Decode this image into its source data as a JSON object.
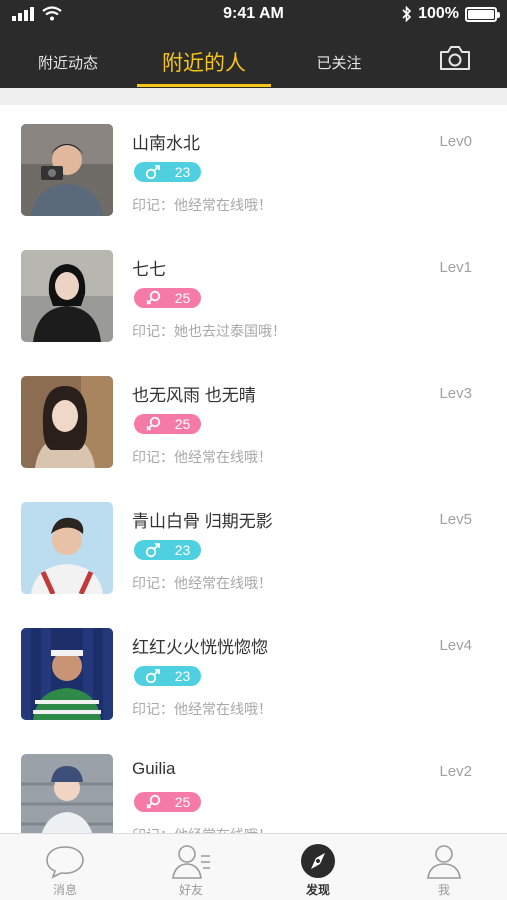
{
  "status_bar": {
    "time": "9:41 AM",
    "battery_percent": "100%",
    "battery_level": 1.0,
    "icons": [
      "signal-icon",
      "wifi-icon",
      "bluetooth-icon",
      "battery-icon"
    ]
  },
  "tabs": [
    {
      "label": "附近动态",
      "active": false
    },
    {
      "label": "附近的人",
      "active": true
    },
    {
      "label": "已关注",
      "active": false
    }
  ],
  "camera_icon": "camera-icon",
  "colors": {
    "top_bar": "#2b2b2b",
    "accent": "#f5c518",
    "male_badge": "#4fd0e0",
    "female_badge": "#f57aa6"
  },
  "people": [
    {
      "name": "山南水北",
      "level": "Lev0",
      "gender": "male",
      "age": "23",
      "note": "印记：他经常在线哦！"
    },
    {
      "name": "七七",
      "level": "Lev1",
      "gender": "female",
      "age": "25",
      "note": "印记：她也去过泰国哦！"
    },
    {
      "name": "也无风雨 也无晴",
      "level": "Lev3",
      "gender": "female",
      "age": "25",
      "note": "印记：他经常在线哦！"
    },
    {
      "name": "青山白骨 归期无影",
      "level": "Lev5",
      "gender": "male",
      "age": "23",
      "note": "印记：他经常在线哦！"
    },
    {
      "name": "红红火火恍恍惚惚",
      "level": "Lev4",
      "gender": "male",
      "age": "23",
      "note": "印记：他经常在线哦！"
    },
    {
      "name": "Guilia",
      "level": "Lev2",
      "gender": "female",
      "age": "25",
      "note": "印记：他经常在线哦！"
    }
  ],
  "bottom_nav": [
    {
      "label": "消息",
      "icon": "chat-bubble-icon",
      "active": false
    },
    {
      "label": "好友",
      "icon": "friends-icon",
      "active": false
    },
    {
      "label": "发现",
      "icon": "compass-icon",
      "active": true
    },
    {
      "label": "我",
      "icon": "person-icon",
      "active": false
    }
  ]
}
